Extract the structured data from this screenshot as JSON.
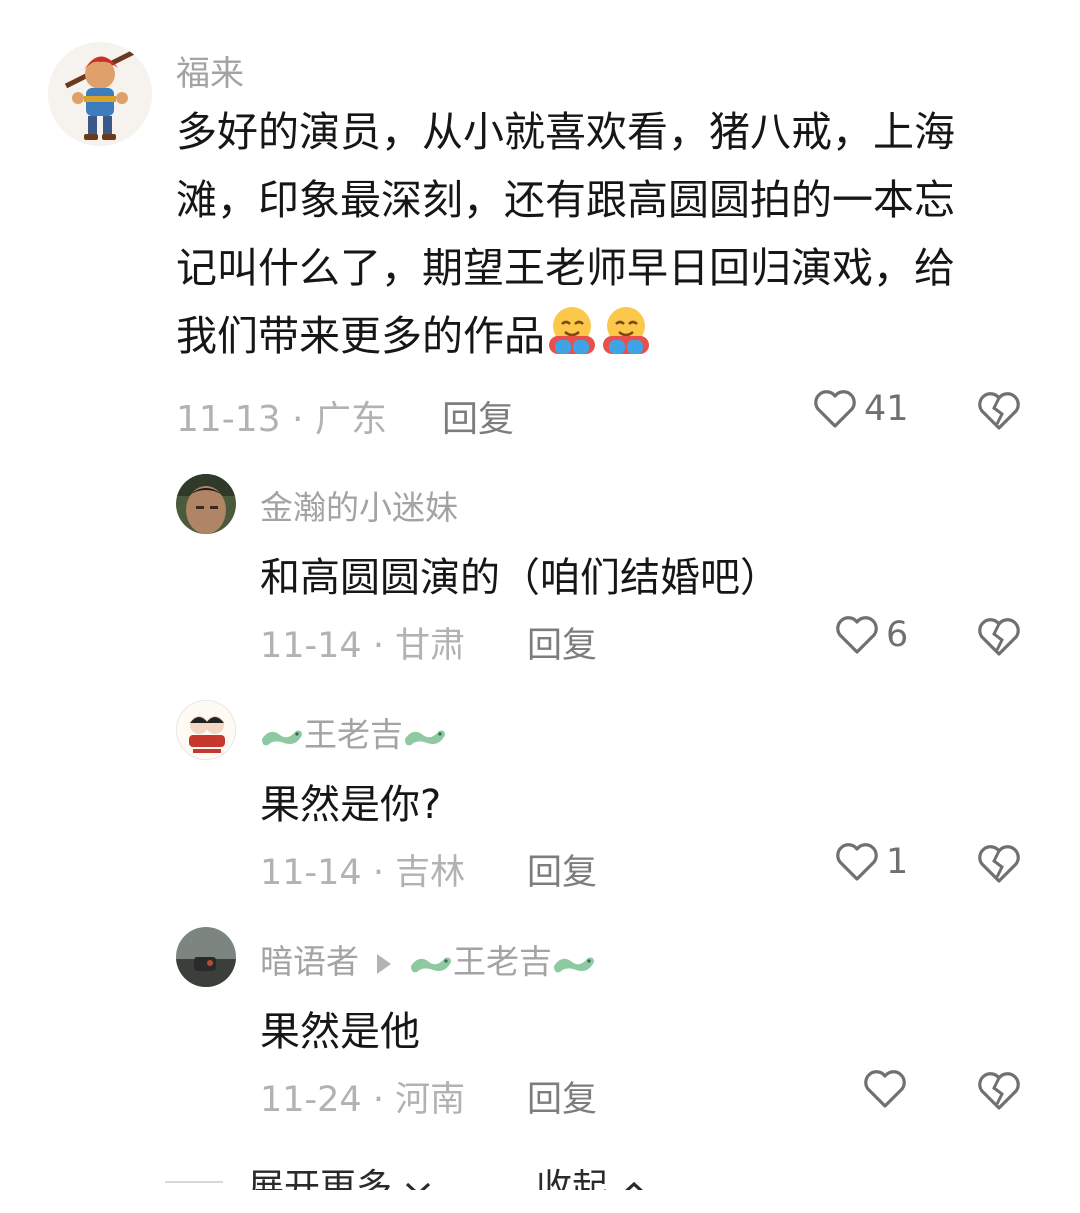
{
  "comments": [
    {
      "author": "福来",
      "lines": [
        "多好的演员，从小就喜欢看，猪八戒，上海",
        "滩，印象最深刻，还有跟高圆圆拍的一本忘",
        "记叫什么了，期望王老师早日回归演戏，给",
        "我们带来更多的作品"
      ],
      "date_location": "11-13 · 广东",
      "reply_label": "回复",
      "likes": "41",
      "avatar_icon": "warrior-cartoon-avatar"
    },
    {
      "author": "金瀚的小迷妹",
      "text": "和高圆圆演的（咱们结婚吧）",
      "date_location": "11-14 · 甘肃",
      "reply_label": "回复",
      "likes": "6"
    },
    {
      "author": "王老吉",
      "text": "果然是你?",
      "date_location": "11-14 · 吉林",
      "reply_label": "回复",
      "likes": "1"
    },
    {
      "author": "暗语者",
      "reply_to": "王老吉",
      "text": "果然是他",
      "date_location": "11-24 · 河南",
      "reply_label": "回复",
      "likes": ""
    }
  ],
  "footer": {
    "expand_label": "展开更多",
    "collapse_label": "收起"
  },
  "colors": {
    "name": "#a3a3a3",
    "meta": "#b2b2b2",
    "text": "#161616",
    "dragon": "#8fc9a2"
  }
}
